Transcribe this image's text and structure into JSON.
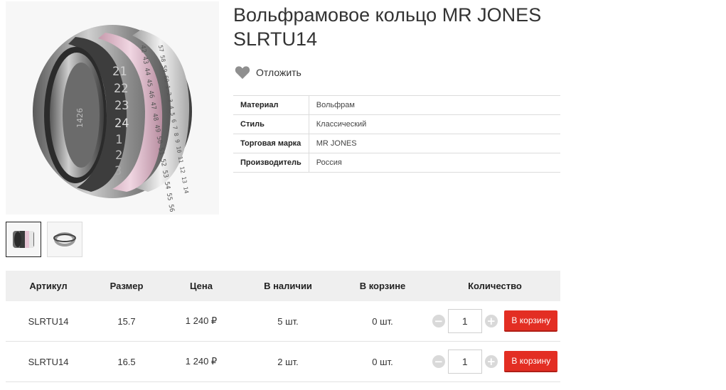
{
  "product": {
    "title": "Вольфрамовое кольцо MR JONES SLRTU14",
    "wishlist_label": "Отложить"
  },
  "colors": {
    "accent": "#e32e23",
    "header_bg": "#efefef",
    "pink": "#e5c4d3"
  },
  "properties": [
    {
      "key": "Материал",
      "value": "Вольфрам"
    },
    {
      "key": "Стиль",
      "value": "Классический"
    },
    {
      "key": "Торговая марка",
      "value": "MR JONES"
    },
    {
      "key": "Производитель",
      "value": "Россия"
    }
  ],
  "image": {
    "ring_digits": [
      "21",
      "22",
      "23",
      "24",
      "1",
      "2",
      "3"
    ],
    "middle_digits": "42 43 44 45 46 47 48 49 50 51 52 53 54 55 56 57",
    "outer_digits": "57 58 59 60 1 2 3 4 5 6 7 8 9 10 11 12 13 14",
    "engraving": "1426"
  },
  "offers": {
    "headers": [
      "Артикул",
      "Размер",
      "Цена",
      "В наличии",
      "В корзине",
      "Количество"
    ],
    "rows": [
      {
        "sku": "SLRTU14",
        "size": "15.7",
        "price": "1 240 ₽",
        "stock": "5 шт.",
        "in_cart": "0 шт.",
        "qty": "1",
        "button": "В корзину"
      },
      {
        "sku": "SLRTU14",
        "size": "16.5",
        "price": "1 240 ₽",
        "stock": "2 шт.",
        "in_cart": "0 шт.",
        "qty": "1",
        "button": "В корзину"
      }
    ],
    "minus": "−",
    "plus": "+"
  }
}
